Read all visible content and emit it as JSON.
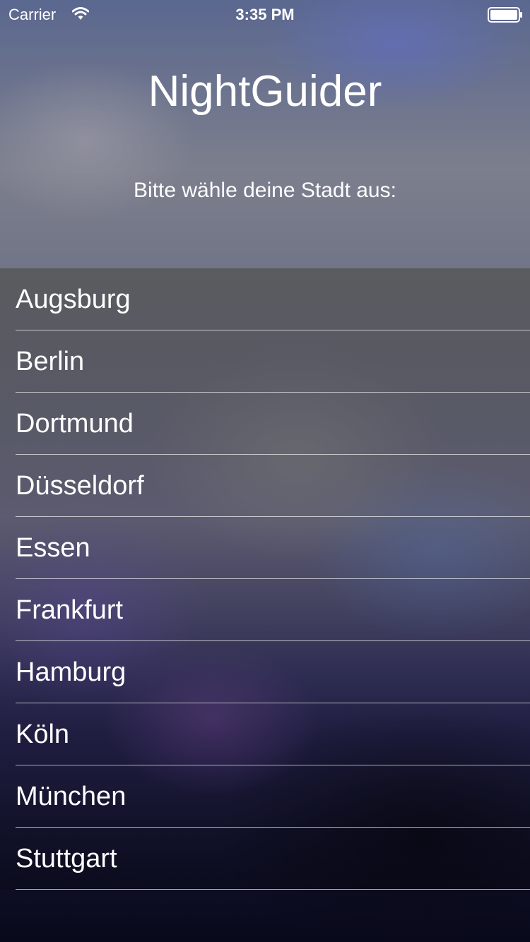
{
  "status_bar": {
    "carrier": "Carrier",
    "time": "3:35 PM",
    "wifi_icon": "wifi-icon",
    "battery_icon": "battery-icon"
  },
  "header": {
    "title": "NightGuider",
    "prompt": "Bitte wähle deine Stadt aus:"
  },
  "cities": [
    {
      "label": "Augsburg"
    },
    {
      "label": "Berlin"
    },
    {
      "label": "Dortmund"
    },
    {
      "label": "Düsseldorf"
    },
    {
      "label": "Essen"
    },
    {
      "label": "Frankfurt"
    },
    {
      "label": "Hamburg"
    },
    {
      "label": "Köln"
    },
    {
      "label": "München"
    },
    {
      "label": "Stuttgart"
    }
  ],
  "colors": {
    "text": "#ffffff",
    "separator": "#ffffff"
  }
}
